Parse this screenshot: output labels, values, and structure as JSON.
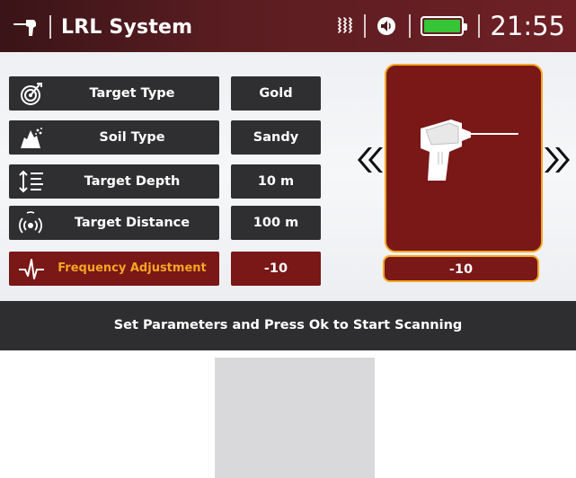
{
  "status_bar": {
    "title": "LRL System",
    "time": "21:55",
    "battery_level": 1.0,
    "battery_color": "#36c536",
    "icons": [
      "metal-detector-icon",
      "vibration-icon",
      "speaker-icon",
      "battery-icon"
    ]
  },
  "parameters": [
    {
      "label": "Target Type",
      "value": "Gold",
      "icon": "target-icon",
      "active": false
    },
    {
      "label": "Soil Type",
      "value": "Sandy",
      "icon": "soil-icon",
      "active": false
    },
    {
      "label": "Target Depth",
      "value": "10 m",
      "icon": "depth-icon",
      "active": false
    },
    {
      "label": "Target Distance",
      "value": "100 m",
      "icon": "signal-icon",
      "active": false
    },
    {
      "label": "Frequency Adjustment",
      "value": "-10",
      "icon": "waveform-icon",
      "active": true
    }
  ],
  "device_panel": {
    "value": "-10",
    "icon": "detector-device-icon",
    "prev_icon": "chevron-double-left-icon",
    "next_icon": "chevron-double-right-icon"
  },
  "message": "Set Parameters and Press Ok to Start Scanning",
  "colors": {
    "accent": "#f5a623",
    "brand": "#7a1717",
    "panel_dark": "#2f2f31"
  }
}
